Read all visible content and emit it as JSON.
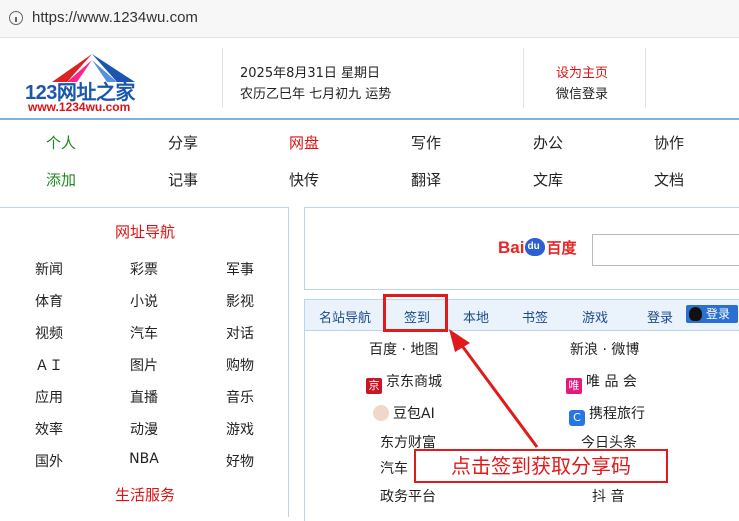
{
  "browser": {
    "url": "https://www.1234wu.com"
  },
  "logo": {
    "brand": "123网址之家",
    "domain": "www.1234wu.com"
  },
  "date": {
    "line1": "2025年8月31日  星期日",
    "line2": "农历乙巳年  七月初九  运势"
  },
  "header_links": {
    "set_home": "设为主页",
    "wechat_login": "微信登录"
  },
  "nav": {
    "row1": [
      "个人",
      "分享",
      "网盘",
      "写作",
      "办公",
      "协作"
    ],
    "row2": [
      "添加",
      "记事",
      "快传",
      "翻译",
      "文库",
      "文档"
    ]
  },
  "sidebar": {
    "title1": "网址导航",
    "items": [
      [
        "新闻",
        "彩票",
        "军事"
      ],
      [
        "体育",
        "小说",
        "影视"
      ],
      [
        "视频",
        "汽车",
        "对话"
      ],
      [
        "ＡＩ",
        "图片",
        "购物"
      ],
      [
        "应用",
        "直播",
        "音乐"
      ],
      [
        "效率",
        "动漫",
        "游戏"
      ],
      [
        "国外",
        "NBA",
        "好物"
      ]
    ],
    "title2": "生活服务"
  },
  "search": {
    "logo_left": "Bai",
    "logo_right": "百度",
    "paw_text": "du"
  },
  "tabs": [
    "名站导航",
    "签到",
    "本地",
    "书签",
    "游戏",
    "登录"
  ],
  "qq_login": "登录",
  "sites": {
    "left": [
      "百度 · 地图",
      "京东商城",
      "豆包AI",
      "东方财富",
      "汽车",
      "政务平台"
    ],
    "right": [
      "新浪 · 微博",
      "唯 品 会",
      "携程旅行",
      "今日头条",
      "抖 音"
    ],
    "icons": {
      "jd": "京",
      "vip": "唯",
      "ctrip": "C"
    }
  },
  "callout": {
    "text": "点击签到获取分享码"
  },
  "colors": {
    "accent_red": "#e01b1b",
    "nav_green": "#1e8a1e",
    "link_blue": "#1a4a8a",
    "border_blue": "#bcd3ec"
  }
}
